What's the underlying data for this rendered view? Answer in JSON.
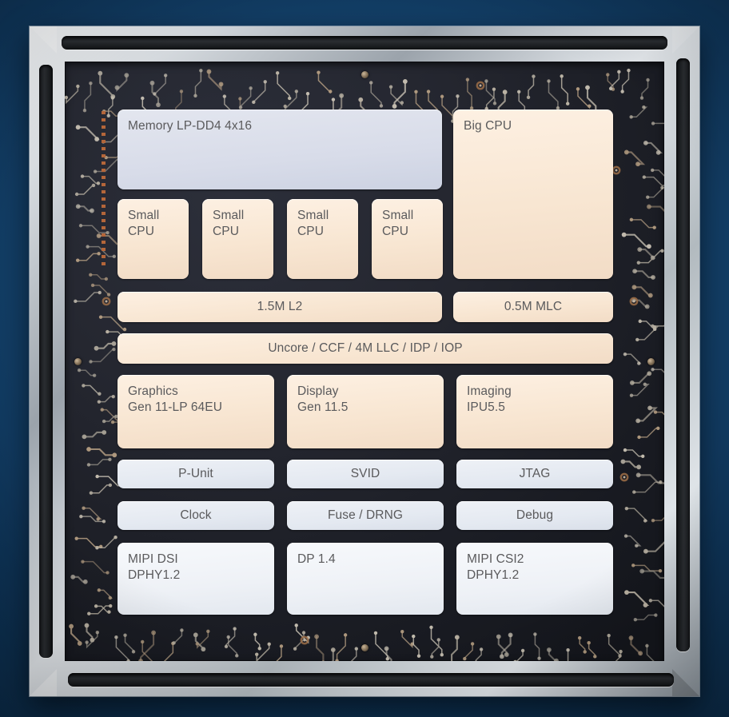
{
  "diagram": {
    "title": "SoC floorplan block diagram",
    "palette": {
      "background_navy": "#0e3356",
      "frame_silver": "#cfd4d9",
      "substrate_dark": "#24262f",
      "block_tan": "#f8e6d2",
      "block_lavender": "#d8dce9",
      "block_bluegrey": "#e4e9f1",
      "block_white": "#eef1f6",
      "label_text": "#5a5a5c",
      "via_copper": "#b4663a"
    },
    "blocks": [
      {
        "name": "memory",
        "line1": "Memory LP-DD4 4x16",
        "line2": "",
        "color": "lav",
        "align": "left"
      },
      {
        "name": "big-cpu",
        "line1": "Big CPU",
        "line2": "",
        "color": "tan",
        "align": "left"
      },
      {
        "name": "small-cpu-1",
        "line1": "Small",
        "line2": "CPU",
        "color": "tan",
        "align": "left"
      },
      {
        "name": "small-cpu-2",
        "line1": "Small",
        "line2": "CPU",
        "color": "tan",
        "align": "left"
      },
      {
        "name": "small-cpu-3",
        "line1": "Small",
        "line2": "CPU",
        "color": "tan",
        "align": "left"
      },
      {
        "name": "small-cpu-4",
        "line1": "Small",
        "line2": "CPU",
        "color": "tan",
        "align": "left"
      },
      {
        "name": "l2-cache",
        "line1": "1.5M L2",
        "line2": "",
        "color": "tan",
        "align": "center"
      },
      {
        "name": "mlc-cache",
        "line1": "0.5M MLC",
        "line2": "",
        "color": "tan",
        "align": "center"
      },
      {
        "name": "uncore",
        "line1": "Uncore / CCF / 4M LLC / IDP / IOP",
        "line2": "",
        "color": "tan",
        "align": "center"
      },
      {
        "name": "graphics",
        "line1": "Graphics",
        "line2": "Gen 11-LP 64EU",
        "color": "tan",
        "align": "left"
      },
      {
        "name": "display",
        "line1": "Display",
        "line2": "Gen 11.5",
        "color": "tan",
        "align": "left"
      },
      {
        "name": "imaging",
        "line1": "Imaging",
        "line2": "IPU5.5",
        "color": "tan",
        "align": "left"
      },
      {
        "name": "p-unit",
        "line1": "P-Unit",
        "line2": "",
        "color": "bluegy",
        "align": "center"
      },
      {
        "name": "svid",
        "line1": "SVID",
        "line2": "",
        "color": "bluegy",
        "align": "center"
      },
      {
        "name": "jtag",
        "line1": "JTAG",
        "line2": "",
        "color": "bluegy",
        "align": "center"
      },
      {
        "name": "clock",
        "line1": "Clock",
        "line2": "",
        "color": "bluegy",
        "align": "center"
      },
      {
        "name": "fuse-drng",
        "line1": "Fuse / DRNG",
        "line2": "",
        "color": "bluegy",
        "align": "center"
      },
      {
        "name": "debug",
        "line1": "Debug",
        "line2": "",
        "color": "bluegy",
        "align": "center"
      },
      {
        "name": "mipi-dsi",
        "line1": "MIPI DSI",
        "line2": "DPHY1.2",
        "color": "white",
        "align": "left"
      },
      {
        "name": "dp",
        "line1": "DP 1.4",
        "line2": "",
        "color": "white",
        "align": "left"
      },
      {
        "name": "mipi-csi2",
        "line1": "MIPI CSI2",
        "line2": "DPHY1.2",
        "color": "white",
        "align": "left"
      }
    ]
  }
}
